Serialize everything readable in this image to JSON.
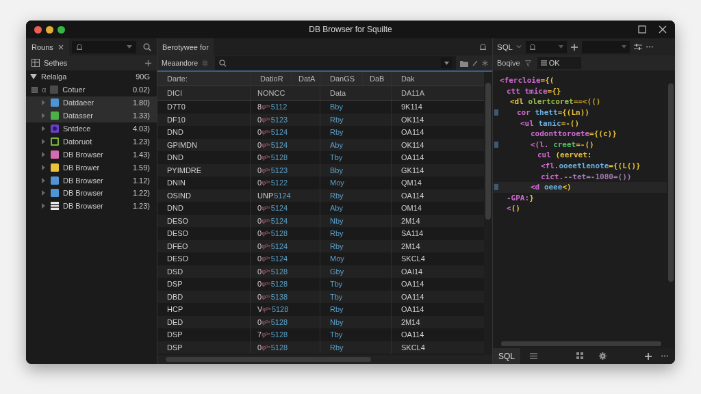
{
  "window": {
    "title": "DB Browser for Squilte"
  },
  "sidebar": {
    "tab": "Rouns",
    "section": "Sethes",
    "tree": [
      {
        "label": "Relalga",
        "count": "90G",
        "expanded": true,
        "children": [
          {
            "label": "Cotuer",
            "count": "0.02)",
            "marker": "α",
            "kind": "checkbox",
            "color": "#4a4a4a",
            "selected": false
          },
          {
            "label": "Datdaeer",
            "count": "1.80)",
            "kind": "square",
            "color": "#4f95d6",
            "selected": true
          },
          {
            "label": "Datasser",
            "count": "1.33)",
            "kind": "square",
            "color": "#4caf48",
            "selected": true
          },
          {
            "label": "Sntdece",
            "count": "4.03)",
            "kind": "ring",
            "color": "#6a3fc8",
            "selected": false
          },
          {
            "label": "Datoruot",
            "count": "1.23)",
            "kind": "outline",
            "color": "#7ab83a",
            "selected": false
          },
          {
            "label": "DB Browser",
            "count": "1.43)",
            "kind": "square",
            "color": "#d46bb0",
            "selected": false
          },
          {
            "label": "DB Brower",
            "count": "1.59)",
            "kind": "square",
            "color": "#e8c23a",
            "selected": false
          },
          {
            "label": "DB Browser",
            "count": "1.12)",
            "kind": "square",
            "color": "#4f95d6",
            "selected": false
          },
          {
            "label": "DB Browser",
            "count": "1.22)",
            "kind": "square",
            "color": "#4f95d6",
            "selected": false
          },
          {
            "label": "DB Browser",
            "count": "1.23)",
            "kind": "striped",
            "color": "#e8e8e8",
            "selected": false
          }
        ]
      }
    ]
  },
  "table": {
    "tab": "Berotywee for",
    "filter_label": "Meaandore",
    "columns": [
      "Darte:",
      "DatioR",
      "DatA",
      "DanGS",
      "DaB",
      "Dak"
    ],
    "subheader": [
      "DICI",
      "NONCC",
      "Data",
      "DA11A"
    ],
    "rows": [
      {
        "name": "D7T0",
        "prefix": "8",
        "mid": "φᵖⁿ",
        "num": "5112",
        "tag": "Bby",
        "code": "9K114"
      },
      {
        "name": "DF10",
        "prefix": "0",
        "mid": "φᵖⁿ",
        "num": "5123",
        "tag": "Rby",
        "code": "OK114"
      },
      {
        "name": "DND",
        "prefix": "0",
        "mid": "φᵖⁿ",
        "num": "5124",
        "tag": "Rby",
        "code": "OA114"
      },
      {
        "name": "GPIMDN",
        "prefix": "0",
        "mid": "φᵖⁿ",
        "num": "5124",
        "tag": "Aby",
        "code": "OK114"
      },
      {
        "name": "DND",
        "prefix": "0",
        "mid": "φᵖⁿ",
        "num": "5128",
        "tag": "Tby",
        "code": "OA114"
      },
      {
        "name": "PYIMDRE",
        "prefix": "0",
        "mid": "φᵖⁿ",
        "num": "5123",
        "tag": "Bby",
        "code": "GK114"
      },
      {
        "name": "DNIN",
        "prefix": "0",
        "mid": "φᵖⁿ",
        "num": "5122",
        "tag": "Moy",
        "code": "QM14"
      },
      {
        "name": "OSIND",
        "prefix": "UNP",
        "mid": "",
        "num": "5124",
        "tag": "Rby",
        "code": "OA114"
      },
      {
        "name": "DND",
        "prefix": "0",
        "mid": "φᵖⁿ",
        "num": "5124",
        "tag": "Aby",
        "code": "OM14"
      },
      {
        "name": "DESO",
        "prefix": "0",
        "mid": "φᵖⁿ",
        "num": "5124",
        "tag": "Nby",
        "code": "2M14"
      },
      {
        "name": "DESO",
        "prefix": "0",
        "mid": "φᵖⁿ",
        "num": "5128",
        "tag": "Rby",
        "code": "SA114"
      },
      {
        "name": "DFEO",
        "prefix": "0",
        "mid": "φᵖⁿ",
        "num": "5124",
        "tag": "Rby",
        "code": "2M14"
      },
      {
        "name": "DESO",
        "prefix": "0",
        "mid": "φᵖⁿ",
        "num": "5124",
        "tag": "Moy",
        "code": "SKCL4"
      },
      {
        "name": "DSD",
        "prefix": "0",
        "mid": "φᵖⁿ",
        "num": "5128",
        "tag": "Gby",
        "code": "OAI14"
      },
      {
        "name": "DSP",
        "prefix": "0",
        "mid": "φᵖⁿ",
        "num": "5128",
        "tag": "Tby",
        "code": "OA114"
      },
      {
        "name": "DBD",
        "prefix": "0",
        "mid": "φᵖⁿ",
        "num": "5138",
        "tag": "Tby",
        "code": "OA114"
      },
      {
        "name": "HCP",
        "prefix": "V",
        "mid": "φᵖⁿ",
        "num": "5128",
        "tag": "Rby",
        "code": "OA114"
      },
      {
        "name": "DED",
        "prefix": "0",
        "mid": "φᵖⁿ",
        "num": "5128",
        "tag": "Nby",
        "code": "2M14"
      },
      {
        "name": "DSP",
        "prefix": "7",
        "mid": "φᵖⁿ",
        "num": "5128",
        "tag": "Tby",
        "code": "OA114"
      },
      {
        "name": "DSP",
        "prefix": "0",
        "mid": "φᵖⁿ",
        "num": "5128",
        "tag": "Rby",
        "code": "SKCL4"
      }
    ]
  },
  "editor": {
    "language": "SQL",
    "label": "Boqive",
    "action": "OK",
    "lines": [
      {
        "marked": false,
        "highlighted": false,
        "tokens": [
          {
            "text": "<fercloie",
            "color": "#d06bd0"
          },
          {
            "text": "={(",
            "color": "#e8c23a"
          }
        ]
      },
      {
        "marked": false,
        "highlighted": false,
        "tokens": [
          {
            "text": "ctt tmice",
            "color": "#d06bd0"
          },
          {
            "text": "={}",
            "color": "#e8c23a"
          }
        ]
      },
      {
        "marked": false,
        "highlighted": false,
        "tokens": [
          {
            "text": "<dl ",
            "color": "#e8c23a"
          },
          {
            "text": "olertcoret",
            "color": "#9bbf4a"
          },
          {
            "text": "==<(()",
            "color": "#c9a22a"
          }
        ]
      },
      {
        "marked": true,
        "highlighted": false,
        "tokens": [
          {
            "text": "cor ",
            "color": "#d06bd0"
          },
          {
            "text": "thett",
            "color": "#6ab0e0"
          },
          {
            "text": "={(Ln))",
            "color": "#e8c23a"
          }
        ]
      },
      {
        "marked": false,
        "highlighted": false,
        "tokens": [
          {
            "text": "<ul ",
            "color": "#d06bd0"
          },
          {
            "text": "tanic",
            "color": "#6ab0e0"
          },
          {
            "text": "=-()",
            "color": "#e8c23a"
          }
        ]
      },
      {
        "marked": false,
        "highlighted": false,
        "tokens": [
          {
            "text": "codonttoroete",
            "color": "#d06bd0"
          },
          {
            "text": "={(c)}",
            "color": "#e8c23a"
          }
        ]
      },
      {
        "marked": true,
        "highlighted": false,
        "tokens": [
          {
            "text": "<(l. ",
            "color": "#d06bd0"
          },
          {
            "text": "creet",
            "color": "#5cbf6a"
          },
          {
            "text": "=-()",
            "color": "#e8c23a"
          }
        ]
      },
      {
        "marked": false,
        "highlighted": false,
        "tokens": [
          {
            "text": "cul ",
            "color": "#d06bd0"
          },
          {
            "text": "(eervet:",
            "color": "#e8c23a"
          }
        ]
      },
      {
        "marked": false,
        "highlighted": false,
        "tokens": [
          {
            "text": "<fl.",
            "color": "#d06bd0"
          },
          {
            "text": "ooeetlenote",
            "color": "#6ab0e0"
          },
          {
            "text": "={(L()}",
            "color": "#e8c23a"
          }
        ]
      },
      {
        "marked": false,
        "highlighted": false,
        "tokens": [
          {
            "text": "cict.",
            "color": "#d06bd0"
          },
          {
            "text": "--tet=-1080=())",
            "color": "#a07ab0"
          }
        ]
      },
      {
        "marked": true,
        "highlighted": true,
        "tokens": [
          {
            "text": "<d ",
            "color": "#d06bd0"
          },
          {
            "text": "oeee",
            "color": "#6ab0e0"
          },
          {
            "text": "<)",
            "color": "#e8c23a"
          }
        ]
      },
      {
        "marked": false,
        "highlighted": false,
        "tokens": [
          {
            "text": "-GPA:",
            "color": "#d06bd0"
          },
          {
            "text": "}",
            "color": "#e8c23a"
          }
        ]
      },
      {
        "marked": false,
        "highlighted": false,
        "tokens": [
          {
            "text": "<",
            "color": "#d06bd0"
          },
          {
            "text": "()",
            "color": "#e8c23a"
          }
        ]
      }
    ],
    "status": "SQL"
  }
}
